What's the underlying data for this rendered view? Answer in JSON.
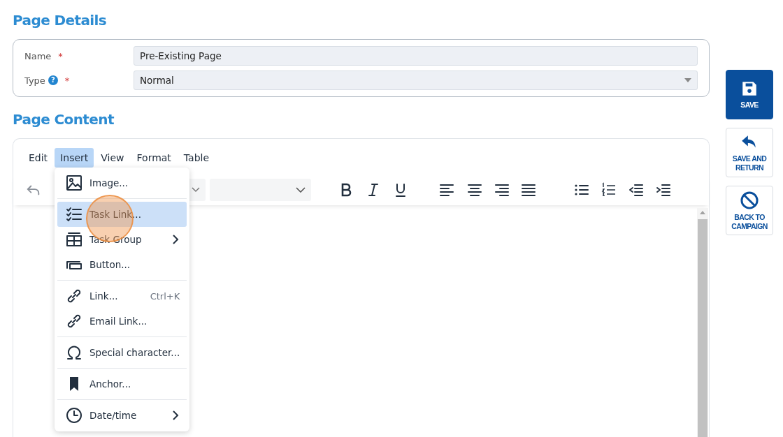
{
  "page_details": {
    "heading": "Page Details",
    "fields": [
      {
        "label": "Name",
        "required_mark": "*",
        "kind": "text",
        "value": "Pre-Existing Page"
      },
      {
        "label": "Type",
        "help": "?",
        "required_mark": "*",
        "kind": "select",
        "value": "Normal"
      }
    ]
  },
  "page_content": {
    "heading": "Page Content",
    "menubar": [
      {
        "label": "Edit",
        "selected": false
      },
      {
        "label": "Insert",
        "selected": true
      },
      {
        "label": "View",
        "selected": false
      },
      {
        "label": "Format",
        "selected": false
      },
      {
        "label": "Table",
        "selected": false
      }
    ],
    "insert_menu": {
      "groups": [
        [
          {
            "kind": "image",
            "label": "Image...",
            "selected": false,
            "submenu": false
          }
        ],
        [
          {
            "kind": "checklist",
            "label": "Task Link...",
            "selected": true,
            "submenu": false
          },
          {
            "kind": "grid",
            "label": "Task Group",
            "selected": false,
            "submenu": true
          },
          {
            "kind": "button",
            "label": "Button...",
            "selected": false,
            "submenu": false
          }
        ],
        [
          {
            "kind": "link",
            "label": "Link...",
            "shortcut": "Ctrl+K",
            "selected": false,
            "submenu": false
          },
          {
            "kind": "link",
            "label": "Email Link...",
            "selected": false,
            "submenu": false
          }
        ],
        [
          {
            "kind": "omega",
            "label": "Special character...",
            "selected": false,
            "submenu": false
          }
        ],
        [
          {
            "kind": "bookmark",
            "label": "Anchor...",
            "selected": false,
            "submenu": false
          }
        ],
        [
          {
            "kind": "clock",
            "label": "Date/time",
            "selected": false,
            "submenu": true
          }
        ]
      ]
    }
  },
  "actions": [
    {
      "kind": "primary",
      "label": "SAVE"
    },
    {
      "kind": "secondary",
      "label": "SAVE AND RETURN"
    },
    {
      "kind": "secondary",
      "label": "BACK TO CAMPAIGN"
    }
  ]
}
